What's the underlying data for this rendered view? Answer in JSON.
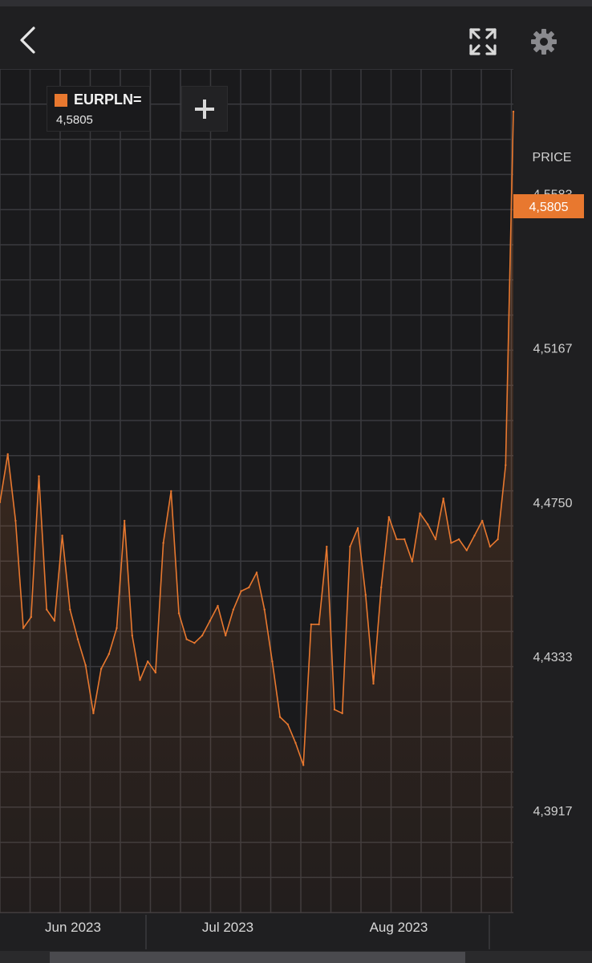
{
  "header": {
    "back_icon": "chevron-left-icon",
    "expand_icon": "expand-arrows-icon",
    "settings_icon": "gear-icon"
  },
  "legend": {
    "symbol": "EURPLN=",
    "value": "4,5805",
    "swatch_color": "#e8782f",
    "add_label": "+"
  },
  "axis": {
    "price_label": "PRICE"
  },
  "chart_data": {
    "type": "area",
    "ylabel": "PRICE",
    "ylim": [
      4.364,
      4.592
    ],
    "y_ticks": [
      "4,5583",
      "4,5167",
      "4,4750",
      "4,4333",
      "4,3917"
    ],
    "x_ticks": [
      "Jun 2023",
      "Jul 2023",
      "Aug 2023"
    ],
    "last_value_label": "4,5805",
    "grid": true,
    "line_color": "#e8782f",
    "series": [
      {
        "name": "EURPLN=",
        "values": [
          4.475,
          4.488,
          4.47,
          4.441,
          4.444,
          4.482,
          4.446,
          4.443,
          4.466,
          4.446,
          4.438,
          4.431,
          4.418,
          4.43,
          4.434,
          4.441,
          4.47,
          4.439,
          4.427,
          4.432,
          4.429,
          4.464,
          4.478,
          4.445,
          4.438,
          4.437,
          4.439,
          4.443,
          4.447,
          4.439,
          4.446,
          4.451,
          4.452,
          4.456,
          4.446,
          4.432,
          4.417,
          4.415,
          4.41,
          4.404,
          4.442,
          4.442,
          4.463,
          4.419,
          4.418,
          4.463,
          4.468,
          4.45,
          4.426,
          4.452,
          4.471,
          4.465,
          4.465,
          4.459,
          4.472,
          4.469,
          4.465,
          4.476,
          4.464,
          4.465,
          4.462,
          4.466,
          4.47,
          4.463,
          4.465,
          4.485,
          4.5805
        ]
      }
    ]
  }
}
